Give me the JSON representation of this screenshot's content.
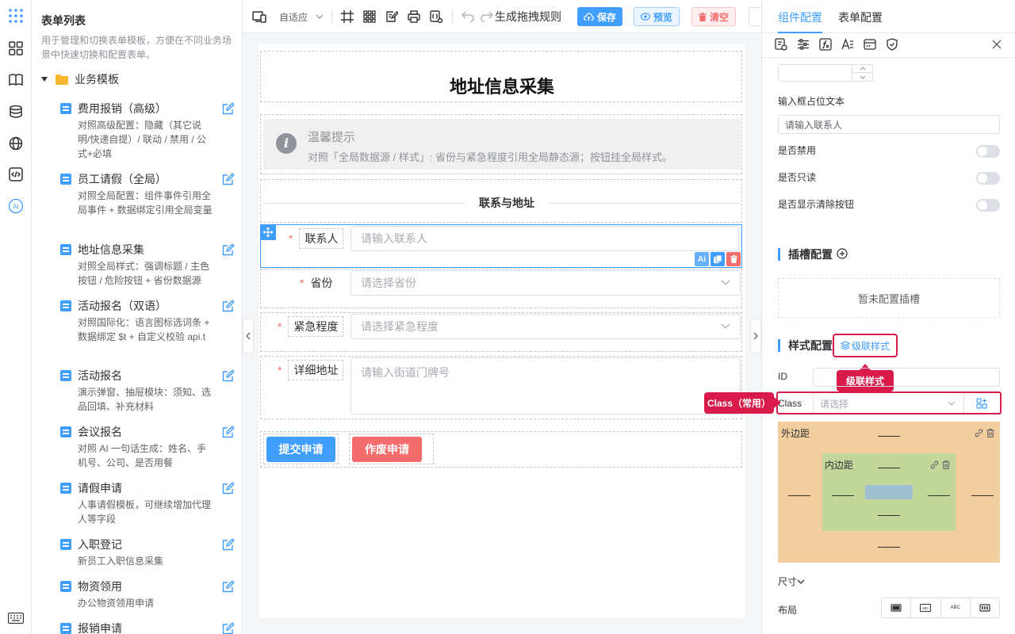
{
  "left_panel": {
    "title": "表单列表",
    "description": "用于管理和切换表单模板，方便在不同业务场景中快速切换和配置表单。",
    "folder": "业务模板",
    "templates": [
      {
        "name": "费用报销（高级）",
        "desc": "对照高级配置：隐藏（其它说明/快递自提）/ 联动 / 禁用 / 公式+必填"
      },
      {
        "name": "员工请假（全局）",
        "desc": "对照全局配置：组件事件引用全局事件 + 数据绑定引用全局变量"
      },
      {
        "name": "地址信息采集",
        "desc": "对照全局样式：强调标题 / 主色按钮 / 危险按钮 + 省份数据源"
      },
      {
        "name": "活动报名（双语）",
        "desc": "对照国际化：语言图标选词条 + 数据绑定 $t + 自定义校验 api.t"
      },
      {
        "name": "活动报名",
        "desc": "演示弹窗、抽屉模块：须知、选品回填、补充材料"
      },
      {
        "name": "会议报名",
        "desc": "对照 AI 一句话生成：姓名、手机号、公司、是否用餐"
      },
      {
        "name": "请假申请",
        "desc": "人事请假模板，可继续增加代理人等字段"
      },
      {
        "name": "入职登记",
        "desc": "新员工入职信息采集"
      },
      {
        "name": "物资领用",
        "desc": "办公物资领用申请"
      },
      {
        "name": "报销申请",
        "desc": ""
      }
    ]
  },
  "toolbar": {
    "adaptive": "自适应",
    "gen_rules": "生成拖拽规则",
    "save": "保存",
    "preview": "预览",
    "clear": "清空"
  },
  "form": {
    "title": "地址信息采集",
    "alert_title": "温馨提示",
    "alert_desc": "对照「全局数据源 / 样式」: 省份与紧急程度引用全局静态源；按钮挂全局样式。",
    "divider": "联系与地址",
    "fields": [
      {
        "label": "联系人",
        "placeholder": "请输入联系人"
      },
      {
        "label": "省份",
        "placeholder": "请选择省份"
      },
      {
        "label": "紧急程度",
        "placeholder": "请选择紧急程度"
      },
      {
        "label": "详细地址",
        "placeholder": "请输入街道门牌号"
      }
    ],
    "ai_badge": "Ai",
    "submit": "提交申请",
    "void": "作废申请"
  },
  "right_panel": {
    "tabs": [
      "组件配置",
      "表单配置"
    ],
    "placeholder_label": "输入框占位文本",
    "placeholder_value": "请输入联系人",
    "disabled_label": "是否禁用",
    "readonly_label": "是否只读",
    "clearable_label": "是否显示清除按钮",
    "slot_title": "插槽配置",
    "slot_empty": "暂未配置插槽",
    "style_title": "样式配置",
    "cascade_btn": "级联样式",
    "cascade_tip": "级联样式",
    "id_label": "ID",
    "class_label": "Class",
    "class_placeholder": "请选择",
    "class_tip": "Class（常用）",
    "margin_label": "外边距",
    "padding_label": "内边距",
    "size_label": "尺寸",
    "layout_label": "布局",
    "layout_opts": [
      "ABC",
      "ABC"
    ]
  },
  "colors": {
    "primary": "#409eff",
    "danger": "#f56c6c",
    "highlight": "#d81b4a",
    "margin_box": "#f2cd9e",
    "padding_box": "#c4d79b",
    "content_box": "#a0bfd0"
  }
}
